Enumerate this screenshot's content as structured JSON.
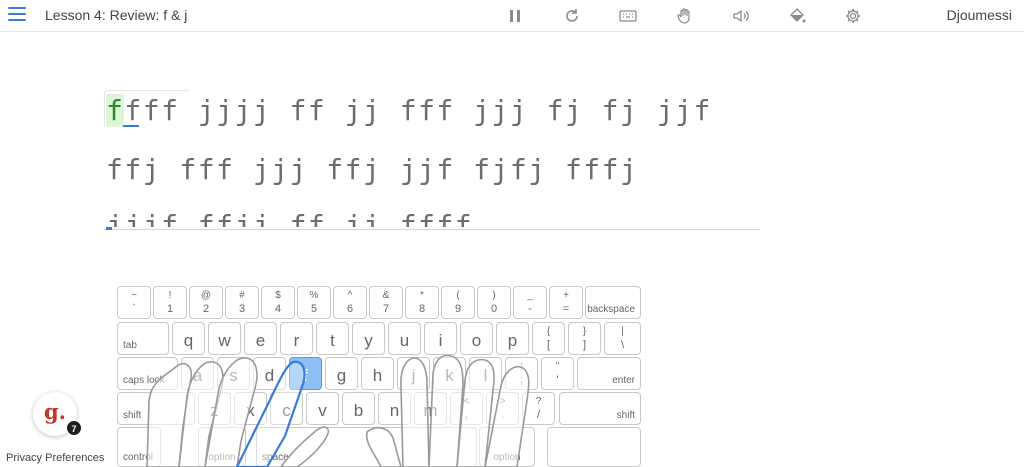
{
  "header": {
    "lesson_title": "Lesson 4: Review: f & j",
    "username": "Djoumessi",
    "tools": [
      "pause-icon",
      "restart-icon",
      "keyboard-icon",
      "hand-icon",
      "volume-icon",
      "paint-bucket-icon",
      "gear-icon"
    ]
  },
  "practice": {
    "line1_current": "f",
    "line1_rest": "fff jjjj ff jj fff jjj fj fj jjf",
    "line2": "ffj fff jjj ffj jjf fjfj fffj",
    "line3": "jjjf ffjj ff jj ffff"
  },
  "keyboard": {
    "row1": [
      {
        "top": "~",
        "bot": "`"
      },
      {
        "top": "!",
        "bot": "1"
      },
      {
        "top": "@",
        "bot": "2"
      },
      {
        "top": "#",
        "bot": "3"
      },
      {
        "top": "$",
        "bot": "4"
      },
      {
        "top": "%",
        "bot": "5"
      },
      {
        "top": "^",
        "bot": "6"
      },
      {
        "top": "&",
        "bot": "7"
      },
      {
        "top": "*",
        "bot": "8"
      },
      {
        "top": "(",
        "bot": "9"
      },
      {
        "top": ")",
        "bot": "0"
      },
      {
        "top": "_",
        "bot": "-"
      },
      {
        "top": "+",
        "bot": "="
      }
    ],
    "backspace": "backspace",
    "tab": "tab",
    "row2": [
      "q",
      "w",
      "e",
      "r",
      "t",
      "y",
      "u",
      "i",
      "o",
      "p"
    ],
    "row2_sym": [
      {
        "top": "{",
        "bot": "["
      },
      {
        "top": "}",
        "bot": "]"
      },
      {
        "top": "|",
        "bot": "\\"
      }
    ],
    "caps": "caps lock",
    "row3": [
      "a",
      "s",
      "d",
      "f",
      "g",
      "h",
      "j",
      "k",
      "l"
    ],
    "row3_sym": [
      {
        "top": ":",
        "bot": ";"
      },
      {
        "top": "\"",
        "bot": "'"
      }
    ],
    "enter": "enter",
    "shift_left": "shift",
    "row4": [
      "z",
      "x",
      "c",
      "v",
      "b",
      "n",
      "m"
    ],
    "row4_sym": [
      {
        "top": "<",
        "bot": ","
      },
      {
        "top": ">",
        "bot": "."
      },
      {
        "top": "?",
        "bot": "/"
      }
    ],
    "shift_right": "shift",
    "control": "control",
    "option_left": "option",
    "space": "space",
    "option_right": "option",
    "active_key": "f"
  },
  "badge": {
    "letter": "g.",
    "count": "7"
  },
  "footer": {
    "privacy": "Privacy Preferences"
  }
}
